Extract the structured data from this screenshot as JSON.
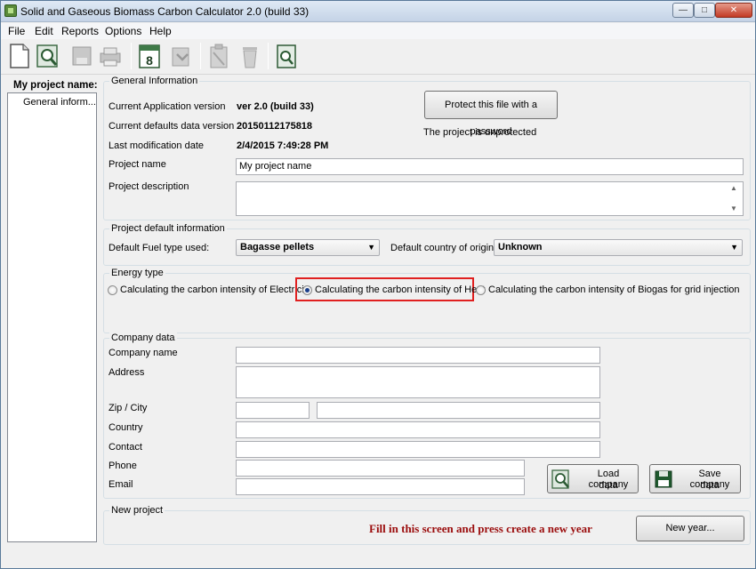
{
  "window": {
    "title": "Solid and Gaseous Biomass Carbon Calculator 2.0 (build 33)",
    "min_glyph": "—",
    "max_glyph": "□",
    "close_glyph": "✕"
  },
  "menu": [
    "File",
    "Edit",
    "Reports",
    "Options",
    "Help"
  ],
  "toolbar_icons": [
    "new-document-icon",
    "open-search-icon",
    "save-icon",
    "print-icon",
    "calendar-icon",
    "undo-icon",
    "clipboard-icon",
    "trash-icon",
    "report-icon"
  ],
  "left_panel": {
    "title": "My project name:",
    "items": [
      "General inform..."
    ]
  },
  "general_info": {
    "group_label": "General Information",
    "app_version_label": "Current Application version",
    "app_version_value": "ver 2.0 (build 33)",
    "defaults_version_label": "Current defaults data version",
    "defaults_version_value": "20150112175818",
    "modified_label": "Last modification date",
    "modified_value": "2/4/2015 7:49:28 PM",
    "protect_button": "Protect this file with a password",
    "protect_status": "The project is unprotected",
    "project_name_label": "Project name",
    "project_name_value": "My project name",
    "project_desc_label": "Project description",
    "project_desc_value": ""
  },
  "defaults": {
    "group_label": "Project default information",
    "fuel_label": "Default Fuel type used:",
    "fuel_value": "Bagasse pellets",
    "country_label": "Default country of origin:",
    "country_value": "Unknown"
  },
  "energy": {
    "group_label": "Energy type",
    "options": [
      {
        "label": "Calculating the carbon intensity of Electricity",
        "selected": false
      },
      {
        "label": "Calculating the carbon intensity of Heat",
        "selected": true
      },
      {
        "label": "Calculating the carbon intensity of Biogas for grid injection",
        "selected": false
      }
    ],
    "highlight_color": "#e02020"
  },
  "company": {
    "group_label": "Company data",
    "name_label": "Company name",
    "address_label": "Address",
    "zip_city_label": "Zip / City",
    "country_label": "Country",
    "contact_label": "Contact",
    "phone_label": "Phone",
    "email_label": "Email",
    "load_button_line1": "Load company",
    "load_button_line2": "data",
    "save_button_line1": "Save company",
    "save_button_line2": "data"
  },
  "new_project": {
    "group_label": "New project",
    "message": "Fill in this screen and press create a new year",
    "message_color": "#9b0d0d",
    "button": "New year..."
  }
}
